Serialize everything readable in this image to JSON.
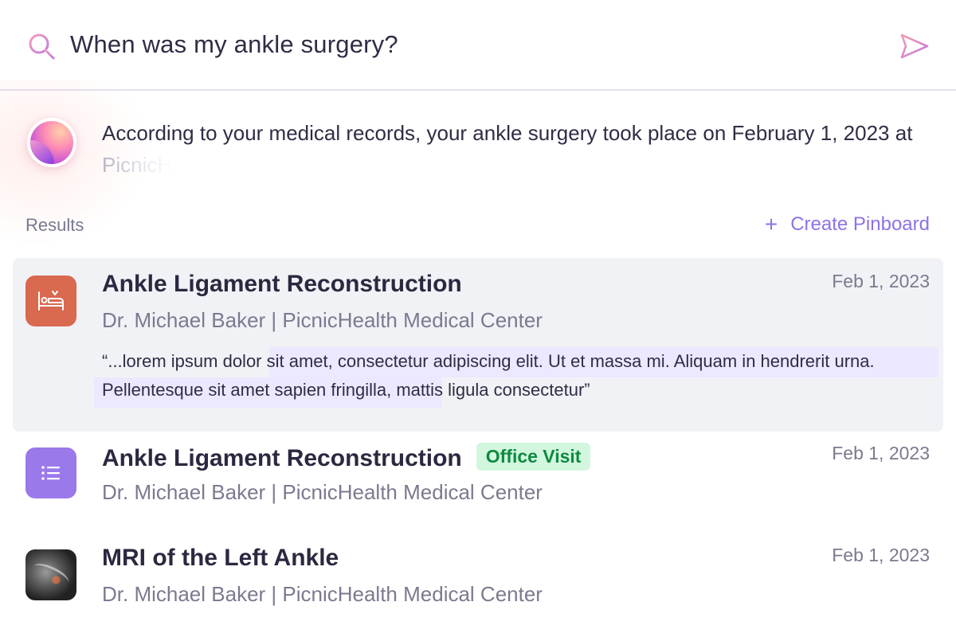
{
  "search": {
    "query": "When was my ankle surgery?",
    "search_icon": "search-icon",
    "send_icon": "send-icon"
  },
  "answer": {
    "text": "According to your medical records, your ankle surgery took place on February 1, 2023 at ",
    "fading_text": "PicnicH"
  },
  "results": {
    "label": "Results",
    "create_pinboard_label": "Create Pinboard",
    "items": [
      {
        "title": "Ankle Ligament Reconstruction",
        "subtitle": "Dr. Michael Baker | PicnicHealth Medical Center",
        "date": "Feb 1, 2023",
        "icon": "hospital-bed-icon",
        "icon_color": "#d9694f",
        "snippet": "“...lorem ipsum dolor sit amet, consectetur adipiscing elit. Ut et massa mi. Aliquam in hendrerit urna. Pellentesque sit amet sapien fringilla, mattis ligula consectetur”"
      },
      {
        "title": "Ankle Ligament Reconstruction",
        "subtitle": "Dr. Michael Baker | PicnicHealth Medical Center",
        "date": "Feb 1, 2023",
        "badge": "Office Visit",
        "icon": "list-icon",
        "icon_color": "#9a79ea"
      },
      {
        "title": "MRI of the Left Ankle",
        "subtitle": "Dr. Michael Baker | PicnicHealth Medical Center",
        "date": "Feb 1, 2023",
        "icon": "mri-thumbnail"
      }
    ]
  },
  "colors": {
    "accent": "#8e72e6",
    "badge_bg": "#d3f6df",
    "badge_text": "#0e8a41",
    "highlight": "#ece8ff"
  }
}
